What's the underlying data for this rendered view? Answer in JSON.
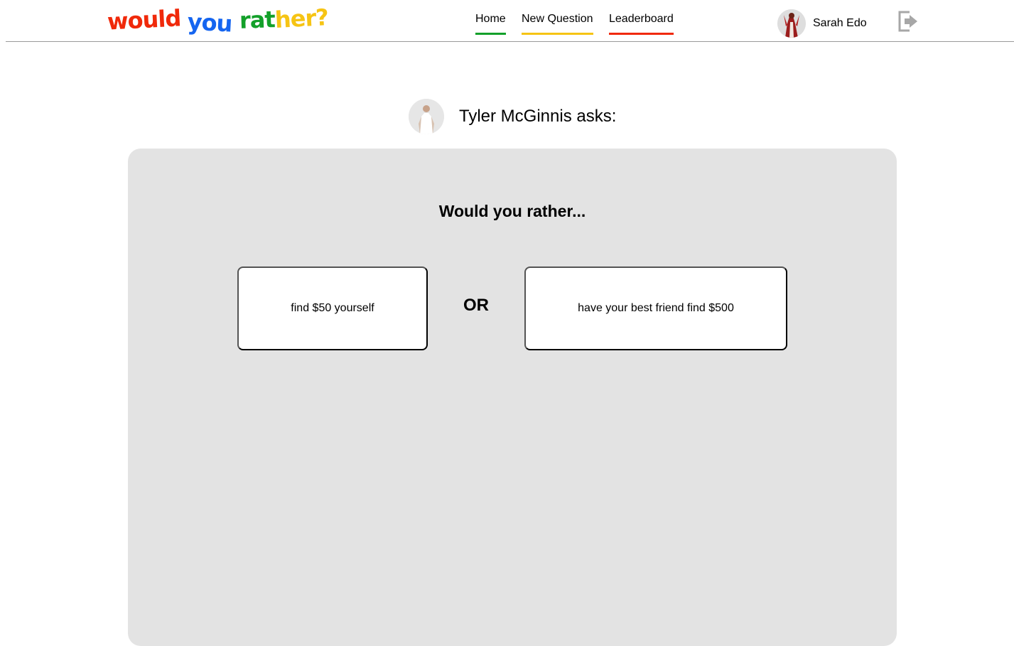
{
  "header": {
    "logo": {
      "word1": "would",
      "word2": "you",
      "word3a": "rat",
      "word3b": "her?"
    },
    "nav": [
      {
        "label": "Home",
        "accent": "#13a02a"
      },
      {
        "label": "New Question",
        "accent": "#f6c414"
      },
      {
        "label": "Leaderboard",
        "accent": "#f0290a"
      }
    ],
    "user": {
      "name": "Sarah Edo",
      "avatar_icon": "user-avatar-icon"
    },
    "logout_icon": "sign-out-icon"
  },
  "question": {
    "asker": "Tyler McGinnis asks:",
    "title": "Would you rather...",
    "option_one": "find $50 yourself",
    "separator": "OR",
    "option_two": "have your best friend find $500"
  },
  "colors": {
    "card_background": "#e3e3e3",
    "logo_red": "#f0290a",
    "logo_blue": "#1565f0",
    "logo_green": "#13a02a",
    "logo_yellow": "#f6c414"
  }
}
